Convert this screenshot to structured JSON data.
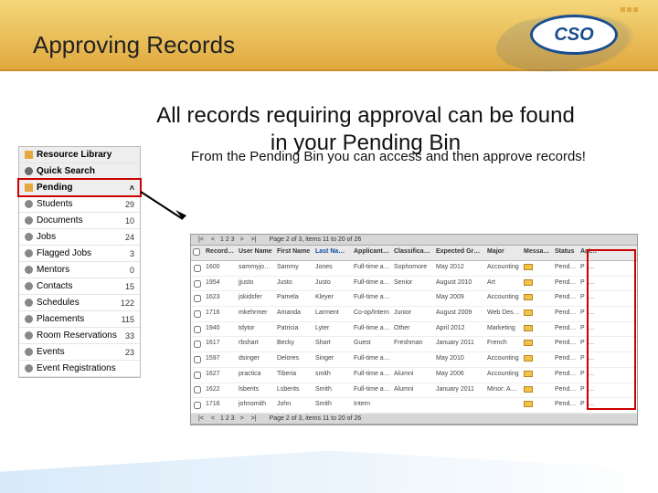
{
  "header": {
    "title": "Approving Records",
    "logo_text": "CSO"
  },
  "subtitle": "All records requiring approval can be found in your Pending Bin",
  "subtext": "From the Pending Bin you can access and then approve records!",
  "sidebar": {
    "resource": "Resource Library",
    "quick": "Quick Search",
    "pending": "Pending",
    "items": [
      {
        "label": "Students",
        "count": "29"
      },
      {
        "label": "Documents",
        "count": "10"
      },
      {
        "label": "Jobs",
        "count": "24"
      },
      {
        "label": "Flagged Jobs",
        "count": "3"
      },
      {
        "label": "Mentors",
        "count": "0"
      },
      {
        "label": "Contacts",
        "count": "15"
      },
      {
        "label": "Schedules",
        "count": "122"
      },
      {
        "label": "Placements",
        "count": "115"
      },
      {
        "label": "Room Reservations",
        "count": "33"
      },
      {
        "label": "Events",
        "count": "23"
      },
      {
        "label": "Event Registrations",
        "count": ""
      }
    ]
  },
  "table": {
    "toolbar": {
      "pages": "1 2 3",
      "info": "Page 2 of 3, items 11 to 20 of 26"
    },
    "headers": [
      "",
      "Record ID",
      "User Name",
      "First Name",
      "Last Name",
      "Applicant Type",
      "Classification",
      "Expected Graduation",
      "Major",
      "Messaging",
      "Status",
      "Activity"
    ],
    "rows": [
      {
        "id": "1600",
        "user": "sammyjones",
        "first": "Sammy",
        "last": "Jones",
        "type": "Full-time and Part-time",
        "class": "Sophomore",
        "grad": "May 2012",
        "major": "Accounting",
        "status": "Pending",
        "act": "P R D S A"
      },
      {
        "id": "1954",
        "user": "jjusto",
        "first": "Justo",
        "last": "Justo",
        "type": "Full-time and Part-time",
        "class": "Senior",
        "grad": "August 2010",
        "major": "Art",
        "status": "Pending",
        "act": "P R D S A"
      },
      {
        "id": "1623",
        "user": "jskidsfer",
        "first": "Pamela",
        "last": "Kleyer",
        "type": "Full-time and Part-time",
        "class": "",
        "grad": "May 2009",
        "major": "Accounting",
        "status": "Pending",
        "act": "P R D B A"
      },
      {
        "id": "1716",
        "user": "mkehrmer",
        "first": "Amanda",
        "last": "Larment",
        "type": "Co-op/Intern",
        "class": "Junior",
        "grad": "August 2009",
        "major": "Web Design",
        "status": "Pending",
        "act": "P R D S A"
      },
      {
        "id": "1940",
        "user": "tdytor",
        "first": "Patricia",
        "last": "Lyter",
        "type": "Full-time and Part-time",
        "class": "Other",
        "grad": "April 2012",
        "major": "Marketing",
        "status": "Pending",
        "act": "P R D S A"
      },
      {
        "id": "1617",
        "user": "rbshart",
        "first": "Becky",
        "last": "Shart",
        "type": "Guest",
        "class": "Freshman",
        "grad": "January 2011",
        "major": "French",
        "status": "Pending",
        "act": "P R D S A"
      },
      {
        "id": "1597",
        "user": "dsinger",
        "first": "Delores",
        "last": "Singer",
        "type": "Full-time and Part-time",
        "class": "",
        "grad": "May 2010",
        "major": "Accounting",
        "status": "Pending",
        "act": "P R D S A"
      },
      {
        "id": "1627",
        "user": "practica",
        "first": "Tiberia",
        "last": "smith",
        "type": "Full-time and Part-time",
        "class": "Alumni",
        "grad": "May 2006",
        "major": "Accounting",
        "status": "Pending",
        "act": "P R D S A"
      },
      {
        "id": "1622",
        "user": "lsberits",
        "first": "Lsberits",
        "last": "Smith",
        "type": "Full-time and Part-time",
        "class": "Alumni",
        "grad": "January 2011",
        "major": "Minor: Accounting, Photography, Computer Science",
        "status": "Pending",
        "act": "P R D S A"
      },
      {
        "id": "1716",
        "user": "johnsmith",
        "first": "John",
        "last": "Smith",
        "type": "Intern",
        "class": "",
        "grad": "",
        "major": "",
        "status": "Pending",
        "act": "P R D S A"
      }
    ]
  }
}
